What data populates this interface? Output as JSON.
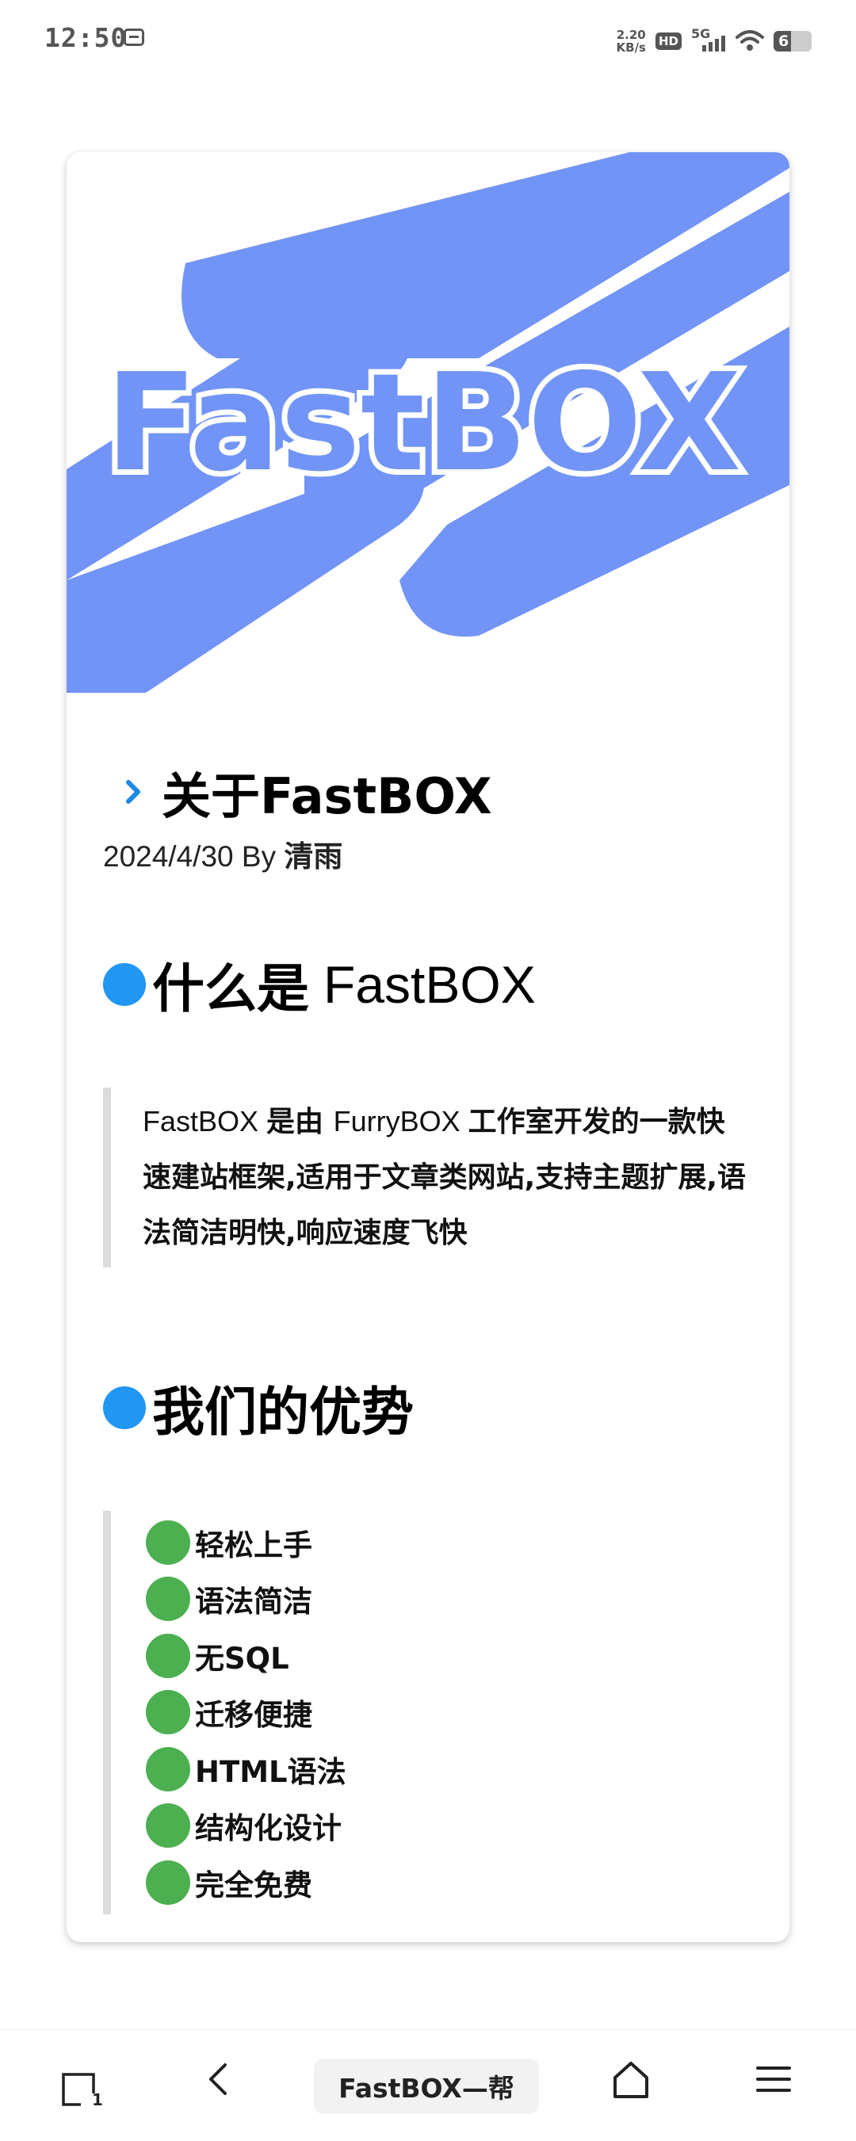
{
  "status_bar": {
    "time": "12:50",
    "speed_value": "2.20",
    "speed_unit": "KB/s",
    "hd_label": "HD",
    "network_label": "5G",
    "battery_level": "6",
    "icons": [
      "message-icon",
      "hd-icon",
      "signal-icon",
      "wifi-icon",
      "battery-icon"
    ]
  },
  "hero": {
    "logo_text": "FastBOX",
    "colors": {
      "brand": "#7294f6",
      "dark_ribbon": "#7a6ff2"
    }
  },
  "post": {
    "title": "关于FastBOX",
    "date": "2024/4/30",
    "by_label": "By",
    "author": "清雨"
  },
  "sections": {
    "what": {
      "heading_cn": "什么是",
      "heading_en": "FastBOX",
      "body_en1": "FastBOX ",
      "body_cn1": "是由 ",
      "body_en2": "FurryBOX ",
      "body_cn2": "工作室开发的一款快速建站框架,适用于文章类网站,支持主题扩展,语法简洁明快,响应速度飞快"
    },
    "advantages": {
      "heading": "我们的优势",
      "items": [
        "轻松上手",
        "语法简洁",
        "无SQL",
        "迁移便捷",
        "HTML语法",
        "结构化设计",
        "完全免费"
      ]
    }
  },
  "colors": {
    "heading_dot": "#2196f3",
    "list_dot": "#4caf50",
    "quote_border": "#dcdcdc"
  },
  "bottom_nav": {
    "tab_count": "1",
    "page_title": "FastBOX—帮",
    "icons": [
      "tabs-icon",
      "back-icon",
      "home-icon",
      "menu-icon"
    ]
  }
}
